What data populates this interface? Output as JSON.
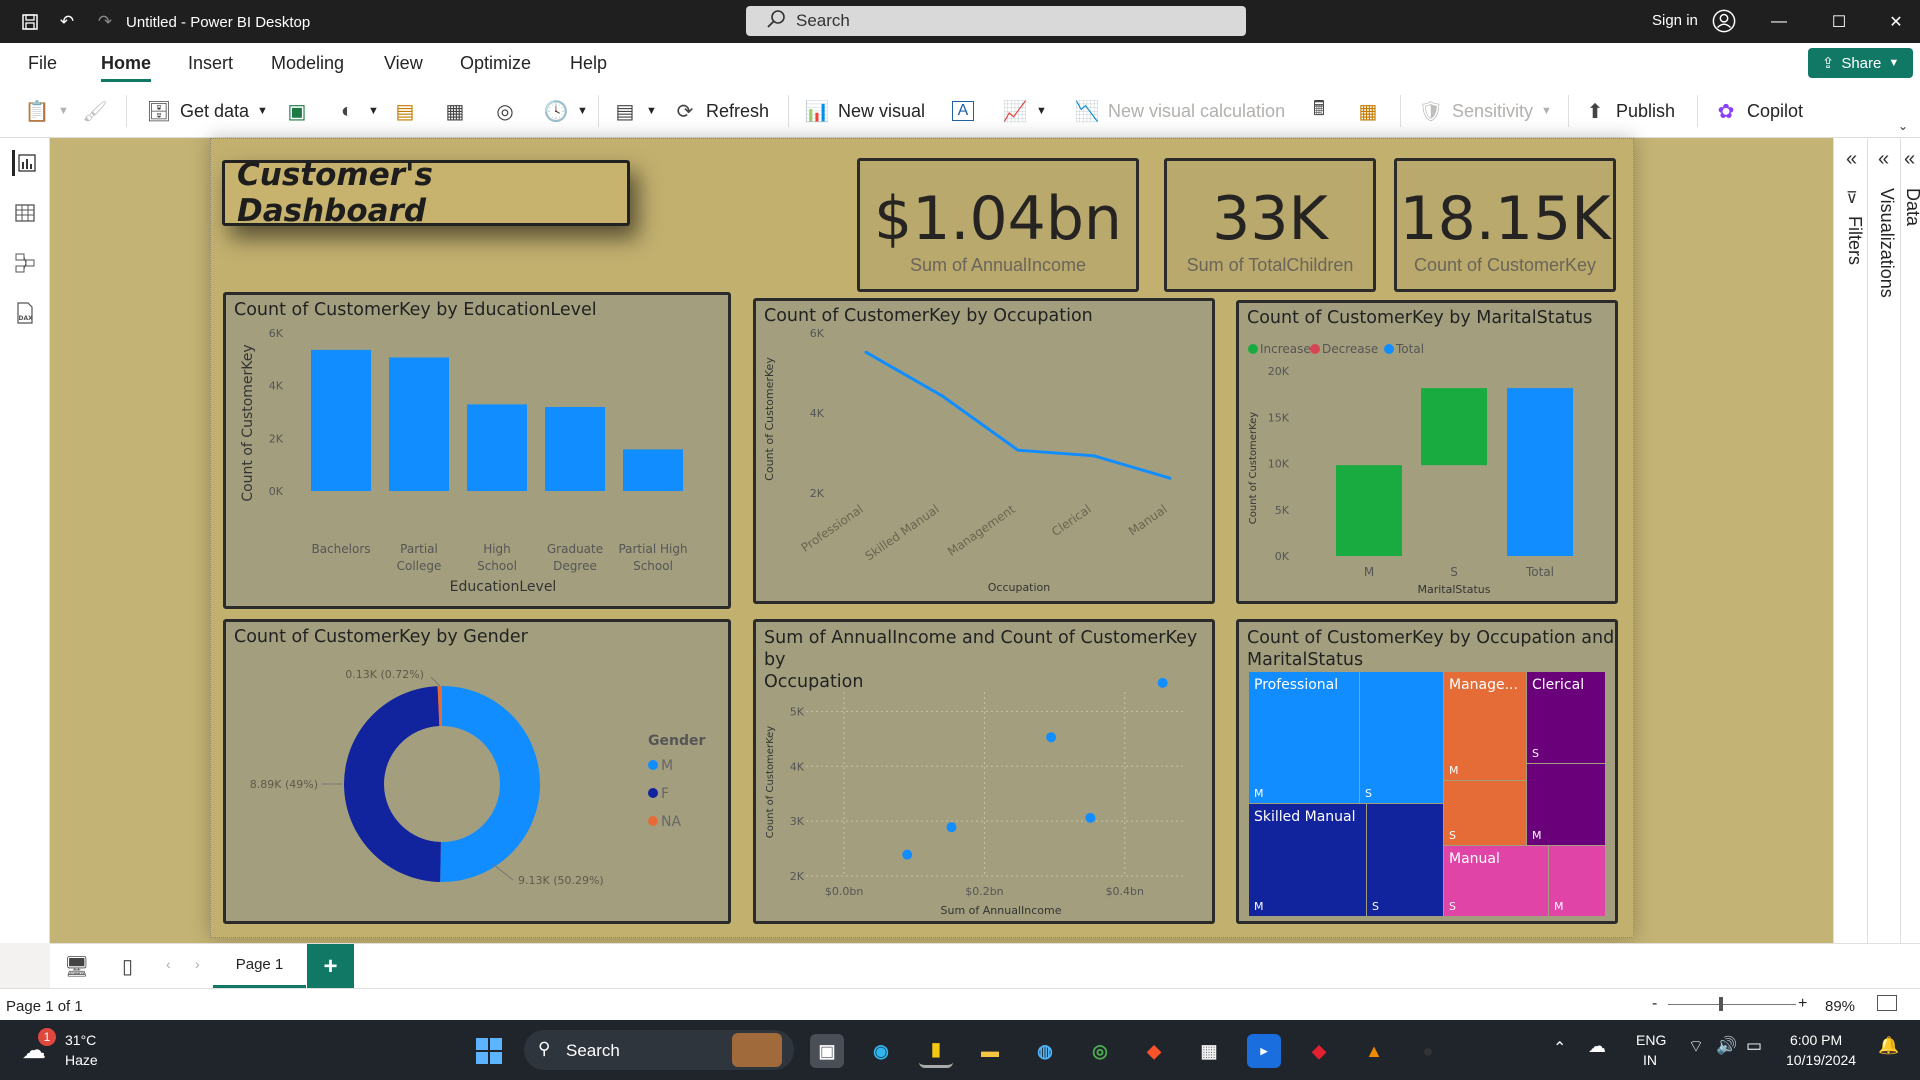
{
  "titlebar": {
    "title": "Untitled - Power BI Desktop",
    "search_placeholder": "Search",
    "sign_in": "Sign in"
  },
  "menu": {
    "tabs": [
      "File",
      "Home",
      "Insert",
      "Modeling",
      "View",
      "Optimize",
      "Help"
    ],
    "active": "Home",
    "share": "Share"
  },
  "ribbon": {
    "get_data": "Get data",
    "refresh": "Refresh",
    "new_visual": "New visual",
    "new_visual_calc": "New visual calculation",
    "sensitivity": "Sensitivity",
    "publish": "Publish",
    "copilot": "Copilot"
  },
  "panes": {
    "filters": "Filters",
    "visualizations": "Visualizations",
    "data": "Data"
  },
  "dashboard": {
    "title": "Customer's Dashboard",
    "kpis": [
      {
        "value": "$1.04bn",
        "label": "Sum of AnnualIncome"
      },
      {
        "value": "33K",
        "label": "Sum of TotalChildren"
      },
      {
        "value": "18.15K",
        "label": "Count of CustomerKey"
      }
    ]
  },
  "charts": {
    "education": {
      "title": "Count of CustomerKey by EducationLevel",
      "xlabel": "EducationLevel",
      "ylabel": "Count of CustomerKey",
      "yticks": [
        "0K",
        "2K",
        "4K",
        "6K"
      ],
      "categories": [
        [
          "Bachelors"
        ],
        [
          "Partial",
          "College"
        ],
        [
          "High",
          "School"
        ],
        [
          "Graduate",
          "Degree"
        ],
        [
          "Partial High",
          "School"
        ]
      ]
    },
    "occupation": {
      "title": "Count of CustomerKey by Occupation",
      "xlabel": "Occupation",
      "ylabel": "Count of CustomerKey",
      "yticks": [
        "2K",
        "4K",
        "6K"
      ],
      "categories": [
        "Professional",
        "Skilled Manual",
        "Management",
        "Clerical",
        "Manual"
      ]
    },
    "marital": {
      "title": "Count of CustomerKey by MaritalStatus",
      "xlabel": "MaritalStatus",
      "ylabel": "Count of CustomerKey",
      "legend": [
        "Increase",
        "Decrease",
        "Total"
      ],
      "yticks": [
        "0K",
        "5K",
        "10K",
        "15K",
        "20K"
      ],
      "categories": [
        "M",
        "S",
        "Total"
      ]
    },
    "gender": {
      "title": "Count of CustomerKey by Gender",
      "legend_title": "Gender",
      "legend": [
        "M",
        "F",
        "NA"
      ],
      "labels": [
        "0.13K (0.72%)",
        "8.89K (49%)",
        "9.13K (50.29%)"
      ]
    },
    "scatter": {
      "title_lines": [
        "Sum of AnnualIncome and Count of CustomerKey by",
        "Occupation"
      ],
      "xlabel": "Sum of AnnualIncome",
      "ylabel": "Count of CustomerKey",
      "xticks": [
        "$0.0bn",
        "$0.2bn",
        "$0.4bn"
      ],
      "yticks": [
        "2K",
        "3K",
        "4K",
        "5K"
      ]
    },
    "treemap": {
      "title_lines": [
        "Count of CustomerKey by Occupation and",
        "MaritalStatus"
      ],
      "cells": [
        "Professional",
        "Skilled Manual",
        "Manage...",
        "Clerical",
        "Manual"
      ]
    }
  },
  "chart_data": [
    {
      "type": "bar",
      "title": "Count of CustomerKey by EducationLevel",
      "xlabel": "EducationLevel",
      "ylabel": "Count of CustomerKey",
      "categories": [
        "Bachelors",
        "Partial College",
        "High School",
        "Graduate Degree",
        "Partial High School"
      ],
      "values": [
        5360,
        5070,
        3290,
        3190,
        1580
      ],
      "ylim": [
        0,
        6000
      ],
      "color": "#118dff"
    },
    {
      "type": "line",
      "title": "Count of CustomerKey by Occupation",
      "xlabel": "Occupation",
      "ylabel": "Count of CustomerKey",
      "categories": [
        "Professional",
        "Skilled Manual",
        "Management",
        "Clerical",
        "Manual"
      ],
      "values": [
        5520,
        4430,
        3070,
        2930,
        2370
      ],
      "ylim": [
        2000,
        6000
      ],
      "color": "#118dff"
    },
    {
      "type": "bar",
      "title": "Count of CustomerKey by MaritalStatus",
      "xlabel": "MaritalStatus",
      "ylabel": "Count of CustomerKey",
      "categories": [
        "M",
        "S",
        "Total"
      ],
      "values": [
        9820,
        8330,
        18150
      ],
      "ylim": [
        0,
        20000
      ],
      "series_colors": {
        "Increase": "#1aab40",
        "Decrease": "#d64554",
        "Total": "#118dff"
      }
    },
    {
      "type": "pie",
      "title": "Count of CustomerKey by Gender",
      "categories": [
        "M",
        "F",
        "NA"
      ],
      "values": [
        9130,
        8890,
        130
      ],
      "colors": [
        "#118dff",
        "#12239e",
        "#e66c37"
      ]
    },
    {
      "type": "scatter",
      "title": "Sum of AnnualIncome and Count of CustomerKey by Occupation",
      "xlabel": "Sum of AnnualIncome",
      "ylabel": "Count of CustomerKey",
      "x": [
        0.09,
        0.153,
        0.295,
        0.351,
        0.454
      ],
      "y": [
        2390,
        2890,
        4530,
        3060,
        5520
      ],
      "xlim": [
        -0.05,
        0.52
      ],
      "ylim": [
        2000,
        5700
      ],
      "color": "#118dff"
    },
    {
      "type": "treemap",
      "title": "Count of CustomerKey by Occupation and MaritalStatus",
      "categories": [
        "Professional",
        "Skilled Manual",
        "Management",
        "Clerical",
        "Manual"
      ],
      "colors": [
        "#118dff",
        "#12239e",
        "#e66c37",
        "#6b007b",
        "#e044a7"
      ]
    }
  ],
  "pagebar": {
    "page": "Page 1",
    "add": "+"
  },
  "status": {
    "page_info": "Page 1 of 1",
    "zoom": "89%"
  },
  "taskbar": {
    "weather_temp": "31°C",
    "weather_desc": "Haze",
    "search": "Search",
    "lang1": "ENG",
    "lang2": "IN",
    "time": "6:00 PM",
    "date": "10/19/2024",
    "badge": "1"
  }
}
